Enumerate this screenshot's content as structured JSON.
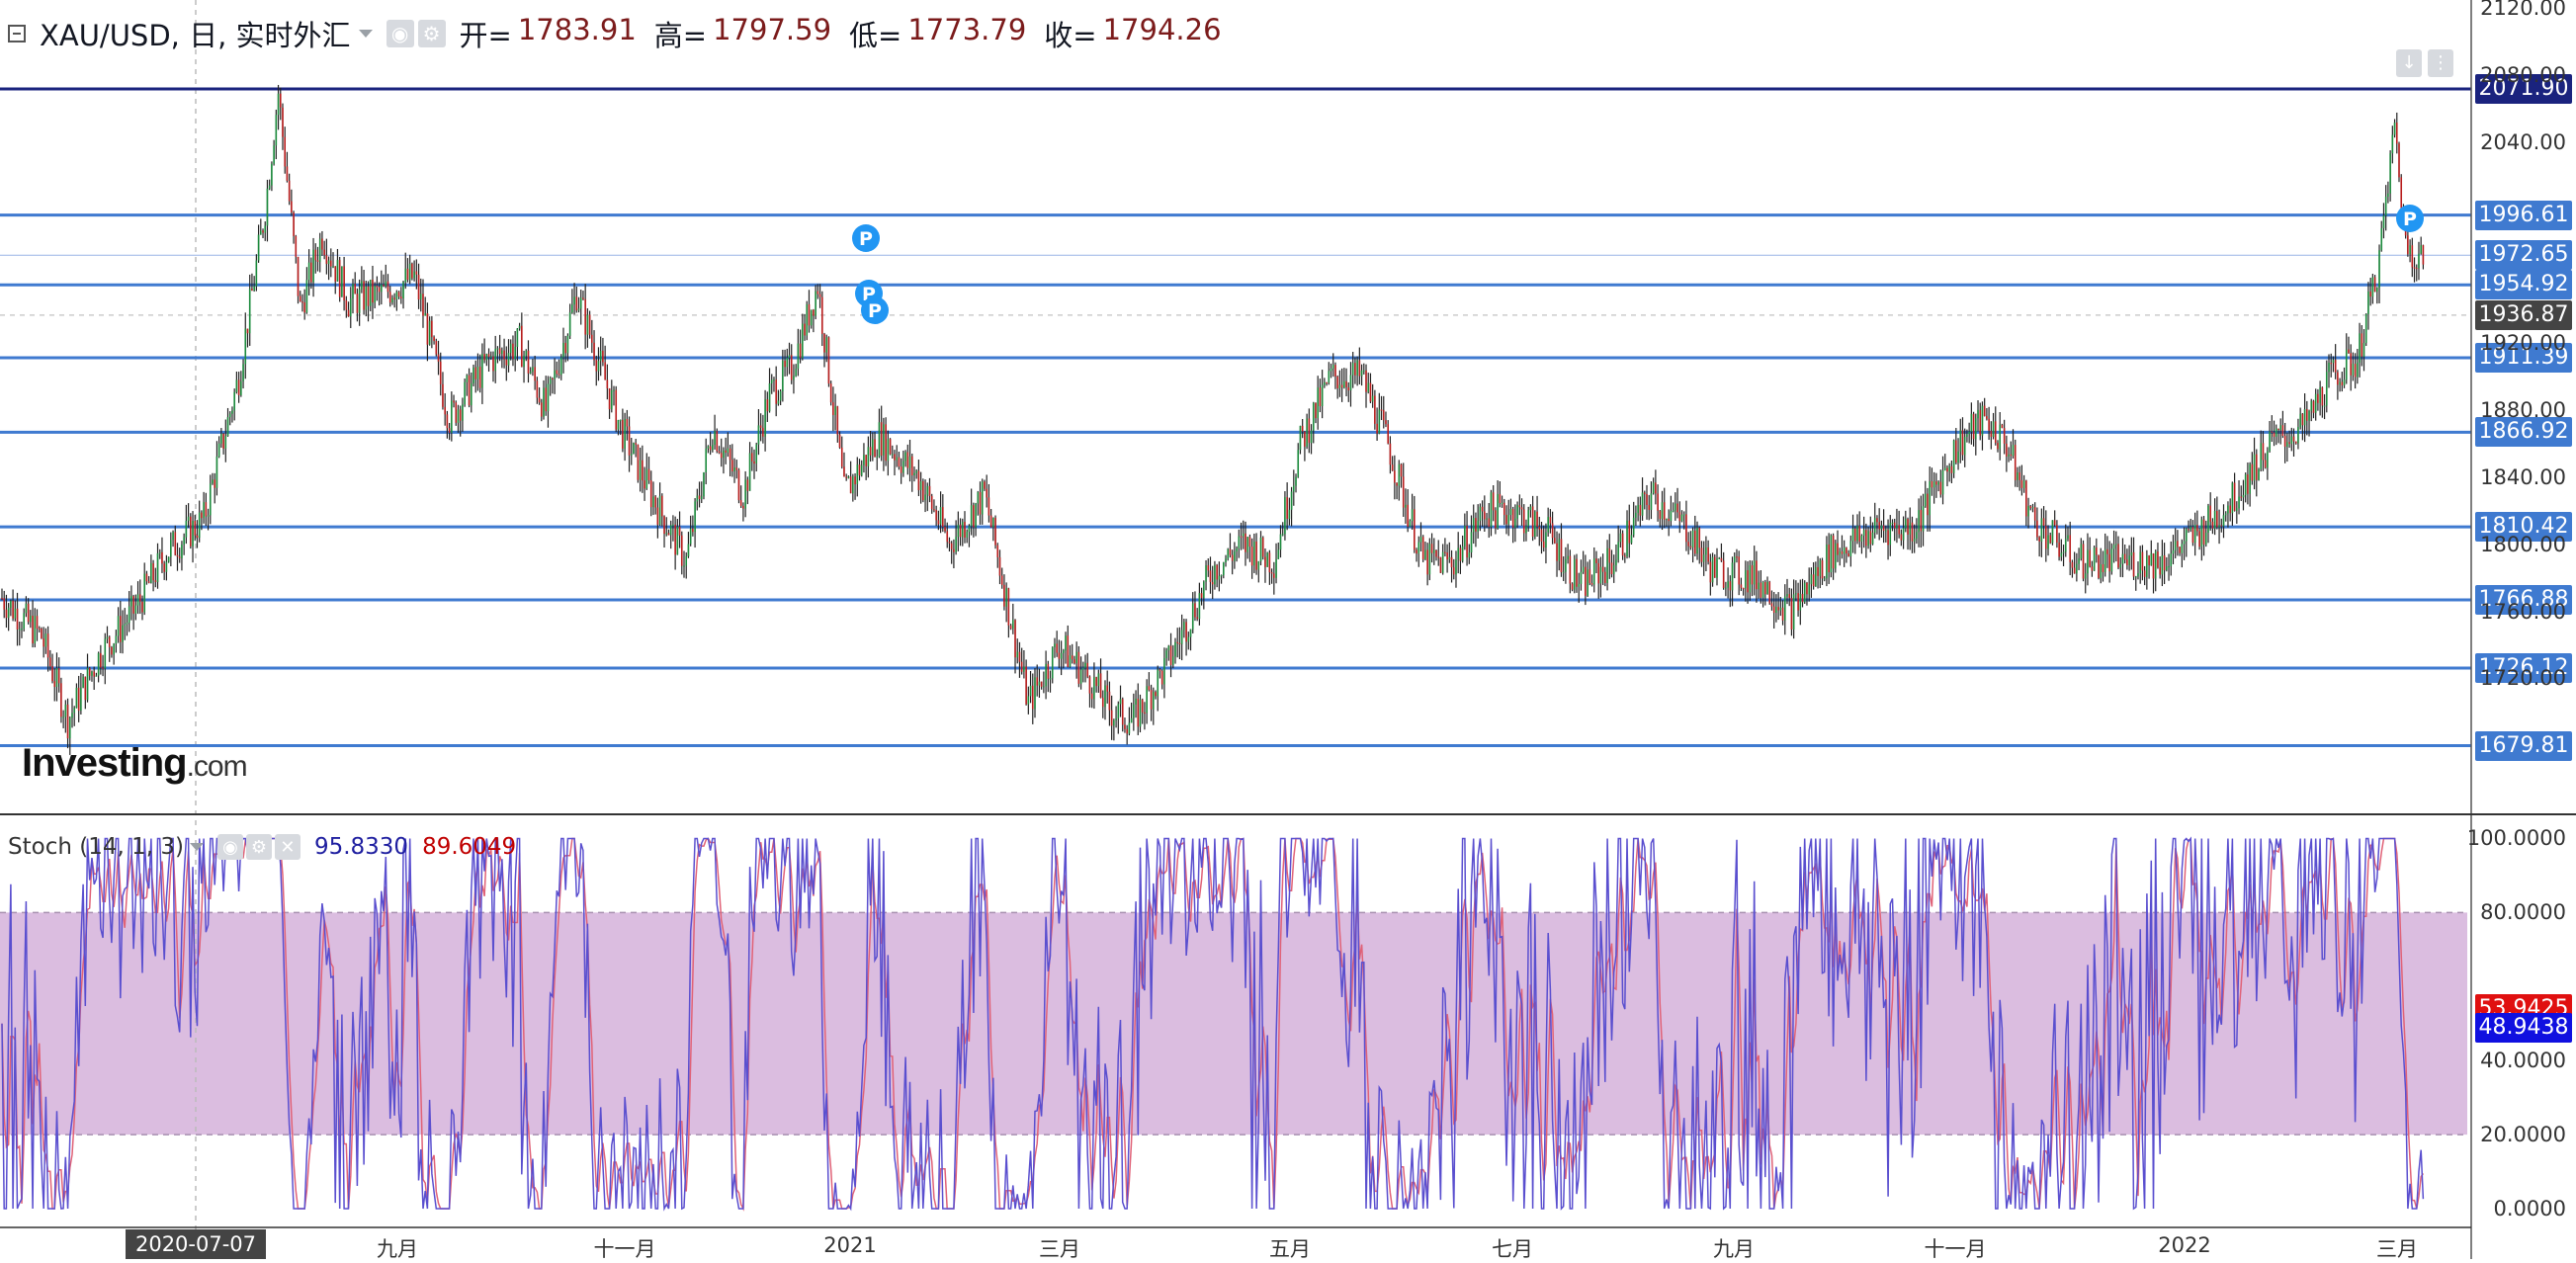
{
  "chart_header": {
    "title": "XAU/USD, 日, 实时外汇",
    "open_label": "开=",
    "open": "1783.91",
    "high_label": "高=",
    "high": "1797.59",
    "low_label": "低=",
    "low": "1773.79",
    "close_label": "收=",
    "close": "1794.26"
  },
  "stoch_header": {
    "title": "Stoch (14, 1, 3)",
    "k": "95.8330",
    "d": "89.6049"
  },
  "watermark": {
    "brand": "Investing",
    "suffix": ".com"
  },
  "colors": {
    "level_line": "#3f7ad0",
    "level_tag": "#3f7ad0",
    "top_line": "#1a237e",
    "top_tag": "#1a237e",
    "up": "#1b8a3c",
    "down": "#b71c1c",
    "stoch_k": "#5a4fcf",
    "stoch_d": "#e06277",
    "stoch_band": "#dbbde0"
  },
  "chart_data": [
    {
      "type": "candlestick",
      "series_name": "XAU/USD",
      "x_labels": [
        "2020-07-07",
        "九月",
        "十一月",
        "2021",
        "三月",
        "五月",
        "七月",
        "九月",
        "十一月",
        "2022",
        "三月"
      ],
      "y_ticks": [
        "2120.00",
        "2080.00",
        "2040.00",
        "1920.00",
        "1880.00",
        "1840.00",
        "1800.00",
        "1760.00",
        "1720.00"
      ],
      "ylim": [
        1640,
        2125
      ],
      "levels": [
        {
          "value": 2071.9,
          "label": "2071.90",
          "style": "top"
        },
        {
          "value": 1996.61,
          "label": "1996.61",
          "style": "level"
        },
        {
          "value": 1972.65,
          "label": "1972.65",
          "style": "current"
        },
        {
          "value": 1954.92,
          "label": "1954.92",
          "style": "level"
        },
        {
          "value": 1936.87,
          "label": "1936.87",
          "style": "cursor"
        },
        {
          "value": 1911.39,
          "label": "1911.39",
          "style": "level"
        },
        {
          "value": 1866.92,
          "label": "1866.92",
          "style": "level"
        },
        {
          "value": 1810.42,
          "label": "1810.42",
          "style": "level"
        },
        {
          "value": 1766.88,
          "label": "1766.88",
          "style": "level"
        },
        {
          "value": 1726.12,
          "label": "1726.12",
          "style": "level"
        },
        {
          "value": 1679.81,
          "label": "1679.81",
          "style": "level"
        }
      ],
      "anchors": [
        [
          0,
          1768
        ],
        [
          18,
          1745
        ],
        [
          30,
          1695
        ],
        [
          45,
          1735
        ],
        [
          60,
          1760
        ],
        [
          75,
          1795
        ],
        [
          92,
          1815
        ],
        [
          108,
          1900
        ],
        [
          120,
          2000
        ],
        [
          126,
          2070
        ],
        [
          136,
          1940
        ],
        [
          146,
          1985
        ],
        [
          158,
          1945
        ],
        [
          174,
          1950
        ],
        [
          188,
          1960
        ],
        [
          204,
          1875
        ],
        [
          222,
          1910
        ],
        [
          236,
          1920
        ],
        [
          248,
          1880
        ],
        [
          262,
          1950
        ],
        [
          282,
          1870
        ],
        [
          296,
          1830
        ],
        [
          312,
          1790
        ],
        [
          324,
          1870
        ],
        [
          338,
          1830
        ],
        [
          350,
          1890
        ],
        [
          360,
          1905
        ],
        [
          372,
          1955
        ],
        [
          384,
          1830
        ],
        [
          400,
          1865
        ],
        [
          418,
          1840
        ],
        [
          432,
          1800
        ],
        [
          448,
          1830
        ],
        [
          468,
          1705
        ],
        [
          482,
          1740
        ],
        [
          496,
          1720
        ],
        [
          506,
          1700
        ],
        [
          516,
          1695
        ],
        [
          532,
          1730
        ],
        [
          552,
          1785
        ],
        [
          566,
          1800
        ],
        [
          580,
          1790
        ],
        [
          592,
          1860
        ],
        [
          606,
          1900
        ],
        [
          620,
          1900
        ],
        [
          632,
          1860
        ],
        [
          648,
          1790
        ],
        [
          662,
          1790
        ],
        [
          676,
          1820
        ],
        [
          690,
          1820
        ],
        [
          706,
          1805
        ],
        [
          720,
          1775
        ],
        [
          734,
          1790
        ],
        [
          752,
          1830
        ],
        [
          768,
          1810
        ],
        [
          780,
          1785
        ],
        [
          800,
          1780
        ],
        [
          816,
          1760
        ],
        [
          834,
          1795
        ],
        [
          856,
          1810
        ],
        [
          872,
          1810
        ],
        [
          892,
          1860
        ],
        [
          904,
          1875
        ],
        [
          914,
          1860
        ],
        [
          926,
          1815
        ],
        [
          946,
          1790
        ],
        [
          966,
          1790
        ],
        [
          984,
          1790
        ],
        [
          1000,
          1805
        ],
        [
          1016,
          1825
        ],
        [
          1034,
          1860
        ],
        [
          1050,
          1870
        ],
        [
          1062,
          1900
        ],
        [
          1074,
          1910
        ],
        [
          1084,
          1970
        ],
        [
          1091,
          2050
        ],
        [
          1096,
          1980
        ],
        [
          1104,
          1970
        ]
      ]
    },
    {
      "type": "line",
      "series_name": "Stoch (14, 1, 3)",
      "y_ticks": [
        "100.0000",
        "80.0000",
        "40.0000",
        "20.0000",
        "0.0000"
      ],
      "ylim": [
        -4,
        106
      ],
      "band": [
        20,
        80
      ],
      "k_last": 48.9438,
      "d_last": 53.9425
    }
  ]
}
